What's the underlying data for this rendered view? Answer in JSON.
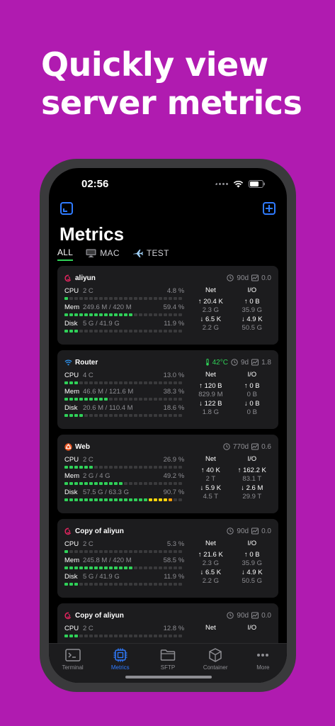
{
  "headline": "Quickly view server metrics",
  "status": {
    "time": "02:56"
  },
  "page_title": "Metrics",
  "tabs": [
    {
      "label": "ALL",
      "icon": "none",
      "active": true
    },
    {
      "label": "MAC",
      "icon": "desktop-icon",
      "active": false
    },
    {
      "label": "TEST",
      "icon": "airplane-icon",
      "active": false
    }
  ],
  "colors": {
    "accent": "#2f7bff",
    "green": "#2fd158",
    "yellow": "#ffd60a",
    "orange": "#ff9f0a",
    "background": "#b01bb0"
  },
  "cards": [
    {
      "name": "aliyun",
      "os_icon": "debian-icon",
      "temp": "",
      "uptime": "90d",
      "load": "0.0",
      "cpu": {
        "label": "CPU",
        "val": "2 C",
        "pct": "4.8 %",
        "fill": 0.048
      },
      "mem": {
        "label": "Mem",
        "val": "249.6 M / 420 M",
        "pct": "59.4 %",
        "fill": 0.594
      },
      "disk": {
        "label": "Disk",
        "val": "5 G / 41.9 G",
        "pct": "11.9 %",
        "fill": 0.119
      },
      "net": {
        "head": "Net",
        "up": "↑ 20.4 K",
        "up_total": "2.3 G",
        "down": "↓ 6.5 K",
        "down_total": "2.2 G"
      },
      "io": {
        "head": "I/O",
        "up": "↑ 0 B",
        "up_total": "35.9 G",
        "down": "↓ 4.9 K",
        "down_total": "50.5 G"
      }
    },
    {
      "name": "Router",
      "os_icon": "wifi-icon",
      "temp": "42°C",
      "uptime": "9d",
      "load": "1.8",
      "cpu": {
        "label": "CPU",
        "val": "4 C",
        "pct": "13.0 %",
        "fill": 0.13
      },
      "mem": {
        "label": "Mem",
        "val": "46.6 M / 121.6 M",
        "pct": "38.3 %",
        "fill": 0.383
      },
      "disk": {
        "label": "Disk",
        "val": "20.6 M / 110.4 M",
        "pct": "18.6 %",
        "fill": 0.186
      },
      "net": {
        "head": "Net",
        "up": "↑ 120 B",
        "up_total": "829.9 M",
        "down": "↓ 122 B",
        "down_total": "1.8 G"
      },
      "io": {
        "head": "I/O",
        "up": "↑ 0 B",
        "up_total": "0 B",
        "down": "↓ 0 B",
        "down_total": "0 B"
      }
    },
    {
      "name": "Web",
      "os_icon": "ubuntu-icon",
      "temp": "",
      "uptime": "770d",
      "load": "0.6",
      "cpu": {
        "label": "CPU",
        "val": "2 C",
        "pct": "26.9 %",
        "fill": 0.269
      },
      "mem": {
        "label": "Mem",
        "val": "2 G / 4 G",
        "pct": "49.2 %",
        "fill": 0.492
      },
      "disk": {
        "label": "Disk",
        "val": "57.5 G / 63.3 G",
        "pct": "90.7 %",
        "fill": 0.907
      },
      "net": {
        "head": "Net",
        "up": "↑ 40 K",
        "up_total": "2 T",
        "down": "↓ 5.9 K",
        "down_total": "4.5 T"
      },
      "io": {
        "head": "I/O",
        "up": "↑ 162.2 K",
        "up_total": "83.1 T",
        "down": "↓ 2.6 M",
        "down_total": "29.9 T"
      }
    },
    {
      "name": "Copy of aliyun",
      "os_icon": "debian-icon",
      "temp": "",
      "uptime": "90d",
      "load": "0.0",
      "cpu": {
        "label": "CPU",
        "val": "2 C",
        "pct": "5.3 %",
        "fill": 0.053
      },
      "mem": {
        "label": "Mem",
        "val": "245.8 M / 420 M",
        "pct": "58.5 %",
        "fill": 0.585
      },
      "disk": {
        "label": "Disk",
        "val": "5 G / 41.9 G",
        "pct": "11.9 %",
        "fill": 0.119
      },
      "net": {
        "head": "Net",
        "up": "↑ 21.6 K",
        "up_total": "2.3 G",
        "down": "↓ 6.5 K",
        "down_total": "2.2 G"
      },
      "io": {
        "head": "I/O",
        "up": "↑ 0 B",
        "up_total": "35.9 G",
        "down": "↓ 4.9 K",
        "down_total": "50.5 G"
      }
    },
    {
      "name": "Copy of aliyun",
      "os_icon": "debian-icon",
      "temp": "",
      "uptime": "90d",
      "load": "0.0",
      "cpu": {
        "label": "CPU",
        "val": "2 C",
        "pct": "12.8 %",
        "fill": 0.128
      },
      "mem": {
        "label": "",
        "val": "",
        "pct": "",
        "fill": 0
      },
      "disk": {
        "label": "",
        "val": "",
        "pct": "",
        "fill": 0
      },
      "net": {
        "head": "Net",
        "up": "",
        "up_total": "",
        "down": "",
        "down_total": ""
      },
      "io": {
        "head": "I/O",
        "up": "",
        "up_total": "",
        "down": "",
        "down_total": ""
      }
    }
  ],
  "tabbar": [
    {
      "label": "Terminal",
      "icon": "terminal-icon",
      "active": false
    },
    {
      "label": "Metrics",
      "icon": "cpu-icon",
      "active": true
    },
    {
      "label": "SFTP",
      "icon": "folder-icon",
      "active": false
    },
    {
      "label": "Container",
      "icon": "cube-icon",
      "active": false
    },
    {
      "label": "More",
      "icon": "ellipsis-icon",
      "active": false
    }
  ]
}
